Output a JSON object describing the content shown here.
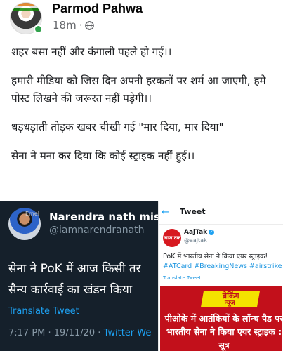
{
  "post": {
    "author": "Parmod Pahwa",
    "time": "18m",
    "separator": "·",
    "paragraphs": [
      "शहर बसा नहीं और कंगाली पहले हो गई।।",
      "हमारी मीडिया को जिस दिन अपनी हरकतों पर शर्म आ जाएगी, हमे पोस्ट लिखने की जरूरत नहीं पड़ेगी।।",
      "धड़धड़ाती तोड़क खबर चीखी गई \"मार दिया, मार दिया\"",
      "सेना ने मना कर दिया कि कोई स्ट्राइक नहीं हुई।।"
    ]
  },
  "tweet_dark": {
    "avatar_text": "Emel",
    "name": "Narendra nath mishr",
    "handle": "@iamnarendranath",
    "text_line1": "सेना ने PoK में आज किसी तर",
    "text_line2": "सैन्य कार्रवाई का खंडन किया",
    "translate_label": "Translate Tweet",
    "time_date": "7:17 PM · 19/11/20 · ",
    "source": "Twitter We"
  },
  "tweet_light": {
    "back_icon": "←",
    "title": "Tweet",
    "avatar_label": "आज तक",
    "name": "AajTak",
    "verified_icon": "✓",
    "handle": "@aajtak",
    "text": "PoK में भारतीय सेना ने किया एयर स्ट्राइक!",
    "hashtags": "#ATCard #BreakingNews #airstrike",
    "translate_label": "Translate Tweet",
    "breaking_line1": "ब्रेकिंग",
    "breaking_line2": "न्यूज़",
    "breaking_text": "पीओके में आतंकियों के लॉन्च पैड पर भारतीय सेना ने किया एयर स्ट्राइक : सूत्र"
  },
  "colors": {
    "twitter_dark_bg": "#15202b",
    "twitter_blue": "#1da1f2",
    "breaking_red": "#c2101b",
    "breaking_yellow": "#f4e200",
    "online_green": "#31a24c"
  }
}
